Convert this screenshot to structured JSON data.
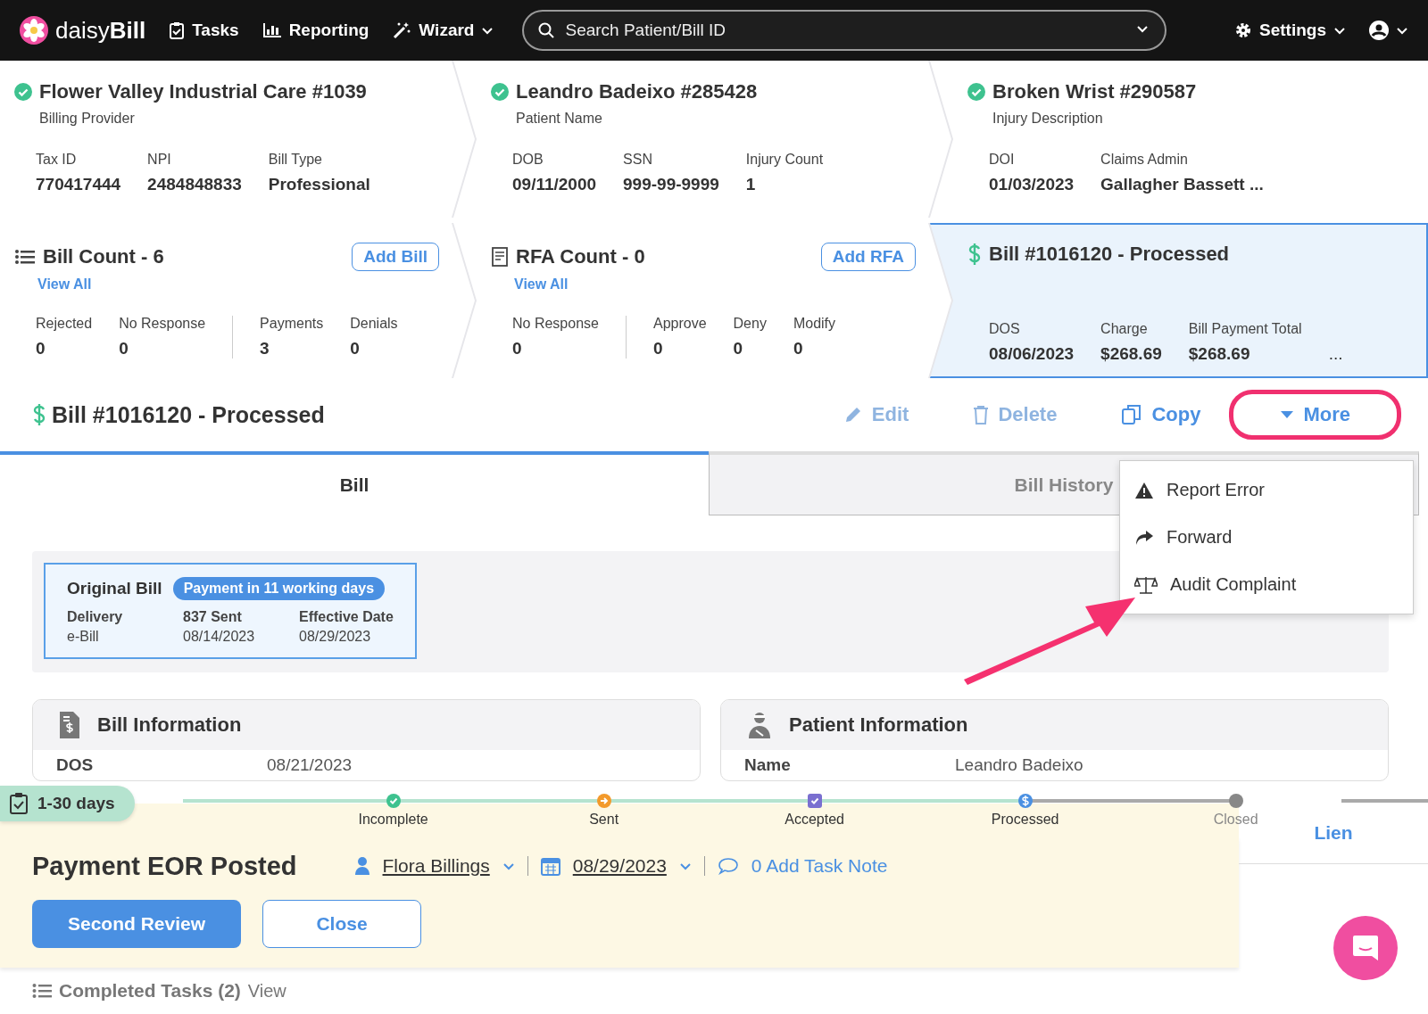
{
  "nav": {
    "logo": "daisy**Bill**",
    "items": [
      {
        "label": "Tasks",
        "dropdown": false
      },
      {
        "label": "Reporting",
        "dropdown": false
      },
      {
        "label": "Wizard",
        "dropdown": true
      }
    ],
    "search": {
      "placeholder": "Search Patient/Bill ID"
    },
    "settings": "Settings"
  },
  "summary_top": [
    {
      "title": "Flower Valley Industrial Care #1039",
      "subtitle": "Billing Provider",
      "verified": true,
      "fields": [
        {
          "label": "Tax ID",
          "value": "770417444"
        },
        {
          "label": "NPI",
          "value": "2484848833"
        },
        {
          "label": "Bill Type",
          "value": "Professional"
        }
      ]
    },
    {
      "title": "Leandro Badeixo #285428",
      "subtitle": "Patient Name",
      "verified": true,
      "fields": [
        {
          "label": "DOB",
          "value": "09/11/2000"
        },
        {
          "label": "SSN",
          "value": "999-99-9999"
        },
        {
          "label": "Injury Count",
          "value": "1"
        }
      ]
    },
    {
      "title": "Broken Wrist #290587",
      "subtitle": "Injury Description",
      "verified": true,
      "fields": [
        {
          "label": "DOI",
          "value": "01/03/2023"
        },
        {
          "label": "Claims Admin",
          "value": "Gallagher Bassett ..."
        }
      ]
    }
  ],
  "summary_bottom": [
    {
      "kind": "count",
      "title": "Bill Count - 6",
      "action": "Add Bill",
      "link": "View All",
      "selected": false,
      "groups": [
        [
          {
            "label": "Rejected",
            "value": "0"
          },
          {
            "label": "No Response",
            "value": "0"
          }
        ],
        [
          {
            "label": "Payments",
            "value": "3"
          },
          {
            "label": "Denials",
            "value": "0"
          }
        ]
      ]
    },
    {
      "kind": "count",
      "title": "RFA Count - 0",
      "action": "Add RFA",
      "link": "View All",
      "selected": false,
      "groups": [
        [
          {
            "label": "No Response",
            "value": "0"
          }
        ],
        [
          {
            "label": "Approve",
            "value": "0"
          },
          {
            "label": "Deny",
            "value": "0"
          },
          {
            "label": "Modify",
            "value": "0"
          }
        ]
      ]
    },
    {
      "kind": "bill",
      "title": "Bill #1016120 - Processed",
      "selected": true,
      "fields": [
        {
          "label": "DOS",
          "value": "08/06/2023"
        },
        {
          "label": "Charge",
          "value": "$268.69"
        },
        {
          "label": "Bill Payment Total",
          "value": "$268.69"
        }
      ],
      "more": "..."
    }
  ],
  "bill_header": {
    "title": "Bill #1016120 - Processed",
    "actions": [
      {
        "label": "Edit",
        "disabled": true,
        "annotated": false
      },
      {
        "label": "Delete",
        "disabled": true,
        "annotated": false
      },
      {
        "label": "Copy",
        "disabled": false,
        "annotated": false
      },
      {
        "label": "More",
        "disabled": false,
        "annotated": true
      }
    ]
  },
  "tabs": [
    {
      "label": "Bill",
      "selected": true
    },
    {
      "label": "Bill History",
      "selected": false
    }
  ],
  "menu": {
    "items": [
      {
        "label": "Report Error"
      },
      {
        "label": "Forward"
      },
      {
        "label": "Audit Complaint"
      }
    ]
  },
  "original_bill": {
    "title": "Original Bill",
    "badge": "Payment in 11 working days",
    "fields": [
      {
        "label": "Delivery",
        "value": "e-Bill"
      },
      {
        "label": "837 Sent",
        "value": "08/14/2023"
      },
      {
        "label": "Effective Date",
        "value": "08/29/2023"
      }
    ]
  },
  "info_cards": [
    {
      "title": "Bill Information",
      "rows": [
        {
          "label": "DOS",
          "value": "08/21/2023"
        }
      ]
    },
    {
      "title": "Patient Information",
      "rows": [
        {
          "label": "Name",
          "value": "Leandro Badeixo"
        }
      ]
    }
  ],
  "task": {
    "age": "1-30 days",
    "stages": [
      {
        "label": "Incomplete",
        "color": "#3ec28f",
        "reached": true
      },
      {
        "label": "Sent",
        "color": "#f39a2b",
        "reached": true
      },
      {
        "label": "Accepted",
        "color": "#7a6fd0",
        "reached": true
      },
      {
        "label": "Processed",
        "color": "#4a90e2",
        "reached": true
      },
      {
        "label": "Closed",
        "color": "#888888",
        "reached": false
      }
    ],
    "title": "Payment EOR Posted",
    "assignee": "Flora Billings",
    "due": "08/29/2023",
    "note": "0 Add Task Note",
    "buttons": [
      {
        "label": "Second Review",
        "primary": true
      },
      {
        "label": "Close",
        "primary": false
      }
    ]
  },
  "side_tab": "Lien",
  "completed": {
    "label": "Completed Tasks (2)",
    "link": "View"
  }
}
